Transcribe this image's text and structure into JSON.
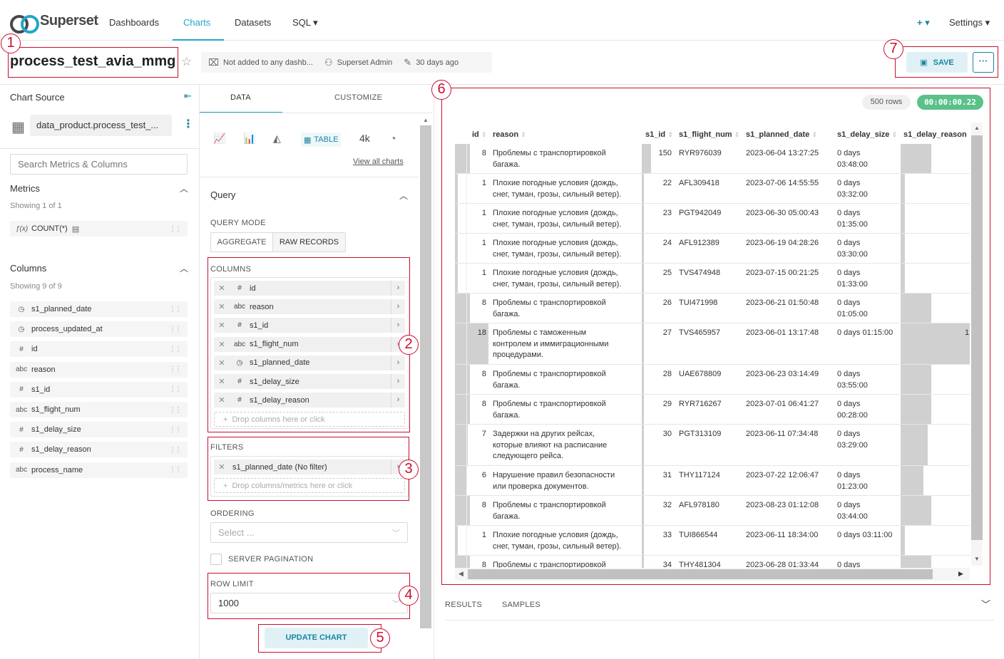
{
  "nav": {
    "brand": "Superset",
    "links": [
      "Dashboards",
      "Charts",
      "Datasets",
      "SQL ▾"
    ],
    "plus": "+ ▾",
    "settings": "Settings ▾"
  },
  "header": {
    "title": "process_test_avia_mmg",
    "dashboards": "Not added to any dashb...",
    "owner": "Superset Admin",
    "modified": "30 days ago",
    "save": "SAVE",
    "more": "···"
  },
  "annotations": [
    "1",
    "2",
    "3",
    "4",
    "5",
    "6",
    "7"
  ],
  "left": {
    "chart_source": "Chart Source",
    "dataset": "data_product.process_test_...",
    "search_placeholder": "Search Metrics & Columns",
    "metrics_title": "Metrics",
    "metrics_showing": "Showing 1 of 1",
    "metric": "COUNT(*)",
    "columns_title": "Columns",
    "columns_showing": "Showing 9 of 9",
    "columns": [
      {
        "type": "clock",
        "name": "s1_planned_date"
      },
      {
        "type": "clock",
        "name": "process_updated_at"
      },
      {
        "type": "#",
        "name": "id"
      },
      {
        "type": "abc",
        "name": "reason"
      },
      {
        "type": "#",
        "name": "s1_id"
      },
      {
        "type": "abc",
        "name": "s1_flight_num"
      },
      {
        "type": "#",
        "name": "s1_delay_size"
      },
      {
        "type": "#",
        "name": "s1_delay_reason"
      },
      {
        "type": "abc",
        "name": "process_name"
      }
    ]
  },
  "control": {
    "tab_data": "DATA",
    "tab_customize": "CUSTOMIZE",
    "viz_table": "TABLE",
    "viz_bignum": "4k",
    "view_all": "View all charts",
    "query_title": "Query",
    "query_mode": "QUERY MODE",
    "mode_aggregate": "AGGREGATE",
    "mode_raw": "RAW RECORDS",
    "columns_label": "COLUMNS",
    "selected_columns": [
      {
        "type": "#",
        "name": "id"
      },
      {
        "type": "abc",
        "name": "reason"
      },
      {
        "type": "#",
        "name": "s1_id"
      },
      {
        "type": "abc",
        "name": "s1_flight_num"
      },
      {
        "type": "clock",
        "name": "s1_planned_date"
      },
      {
        "type": "#",
        "name": "s1_delay_size"
      },
      {
        "type": "#",
        "name": "s1_delay_reason"
      }
    ],
    "columns_drop": "Drop columns here or click",
    "filters_label": "FILTERS",
    "filter": "s1_planned_date (No filter)",
    "filters_drop": "Drop columns/metrics here or click",
    "ordering_label": "ORDERING",
    "ordering_placeholder": "Select ...",
    "server_pagination": "SERVER PAGINATION",
    "row_limit_label": "ROW LIMIT",
    "row_limit": "1000",
    "update": "UPDATE CHART"
  },
  "results": {
    "rows_count": "500 rows",
    "time": "00:00:00.22",
    "headers": [
      "id",
      "reason",
      "s1_id",
      "s1_flight_num",
      "s1_planned_date",
      "s1_delay_size",
      "s1_delay_reason"
    ],
    "rows": [
      {
        "id": "8",
        "idfrac": 0.44,
        "reason": [
          "Проблемы с транспортировкой",
          "багажа."
        ],
        "s1_id": "150",
        "sidfrac": 1.0,
        "flight": "RYR976039",
        "date": "2023-06-04 13:27:25",
        "delay": [
          "0 days",
          "03:48:00"
        ],
        "dr": "",
        "drfrac": 0.44
      },
      {
        "id": "1",
        "idfrac": 0.06,
        "reason": [
          "Плохие погодные условия (дождь,",
          "снег, туман, грозы, сильный ветер)."
        ],
        "s1_id": "22",
        "sidfrac": 0.15,
        "flight": "AFL309418",
        "date": "2023-07-06 14:55:55",
        "delay": [
          "0 days",
          "03:32:00"
        ],
        "dr": "",
        "drfrac": 0.06
      },
      {
        "id": "1",
        "idfrac": 0.06,
        "reason": [
          "Плохие погодные условия (дождь,",
          "снег, туман, грозы, сильный ветер)."
        ],
        "s1_id": "23",
        "sidfrac": 0.15,
        "flight": "PGT942049",
        "date": "2023-06-30 05:00:43",
        "delay": [
          "0 days",
          "01:35:00"
        ],
        "dr": "",
        "drfrac": 0.06
      },
      {
        "id": "1",
        "idfrac": 0.06,
        "reason": [
          "Плохие погодные условия (дождь,",
          "снег, туман, грозы, сильный ветер)."
        ],
        "s1_id": "24",
        "sidfrac": 0.16,
        "flight": "AFL912389",
        "date": "2023-06-19 04:28:26",
        "delay": [
          "0 days",
          "03:30:00"
        ],
        "dr": "",
        "drfrac": 0.06
      },
      {
        "id": "1",
        "idfrac": 0.06,
        "reason": [
          "Плохие погодные условия (дождь,",
          "снег, туман, грозы, сильный ветер)."
        ],
        "s1_id": "25",
        "sidfrac": 0.17,
        "flight": "TVS474948",
        "date": "2023-07-15 00:21:25",
        "delay": [
          "0 days",
          "01:33:00"
        ],
        "dr": "",
        "drfrac": 0.06
      },
      {
        "id": "8",
        "idfrac": 0.44,
        "reason": [
          "Проблемы с транспортировкой",
          "багажа."
        ],
        "s1_id": "26",
        "sidfrac": 0.17,
        "flight": "TUI471998",
        "date": "2023-06-21 01:50:48",
        "delay": [
          "0 days",
          "01:05:00"
        ],
        "dr": "",
        "drfrac": 0.44
      },
      {
        "id": "18",
        "idfrac": 1.0,
        "reason": [
          "Проблемы с таможенным",
          "контролем и иммиграционными",
          "процедурами."
        ],
        "s1_id": "27",
        "sidfrac": 0.18,
        "flight": "TVS465957",
        "date": "2023-06-01 13:17:48",
        "delay": [
          "0 days 01:15:00"
        ],
        "dr": "1",
        "drfrac": 1.0
      },
      {
        "id": "8",
        "idfrac": 0.44,
        "reason": [
          "Проблемы с транспортировкой",
          "багажа."
        ],
        "s1_id": "28",
        "sidfrac": 0.19,
        "flight": "UAE678809",
        "date": "2023-06-23 03:14:49",
        "delay": [
          "0 days",
          "03:55:00"
        ],
        "dr": "",
        "drfrac": 0.44
      },
      {
        "id": "8",
        "idfrac": 0.44,
        "reason": [
          "Проблемы с транспортировкой",
          "багажа."
        ],
        "s1_id": "29",
        "sidfrac": 0.19,
        "flight": "RYR716267",
        "date": "2023-07-01 06:41:27",
        "delay": [
          "0 days",
          "00:28:00"
        ],
        "dr": "",
        "drfrac": 0.44
      },
      {
        "id": "7",
        "idfrac": 0.39,
        "reason": [
          "Задержки на других рейсах,",
          "которые влияют на расписание",
          "следующего рейса."
        ],
        "s1_id": "30",
        "sidfrac": 0.2,
        "flight": "PGT313109",
        "date": "2023-06-11 07:34:48",
        "delay": [
          "0 days",
          "03:29:00"
        ],
        "dr": "",
        "drfrac": 0.39
      },
      {
        "id": "6",
        "idfrac": 0.33,
        "reason": [
          "Нарушение правил безопасности",
          "или проверка документов."
        ],
        "s1_id": "31",
        "sidfrac": 0.21,
        "flight": "THY117124",
        "date": "2023-07-22 12:06:47",
        "delay": [
          "0 days",
          "01:23:00"
        ],
        "dr": "",
        "drfrac": 0.33
      },
      {
        "id": "8",
        "idfrac": 0.44,
        "reason": [
          "Проблемы с транспортировкой",
          "багажа."
        ],
        "s1_id": "32",
        "sidfrac": 0.21,
        "flight": "AFL978180",
        "date": "2023-08-23 01:12:08",
        "delay": [
          "0 days",
          "03:44:00"
        ],
        "dr": "",
        "drfrac": 0.44
      },
      {
        "id": "1",
        "idfrac": 0.06,
        "reason": [
          "Плохие погодные условия (дождь,",
          "снег, туман, грозы, сильный ветер)."
        ],
        "s1_id": "33",
        "sidfrac": 0.22,
        "flight": "TUI866544",
        "date": "2023-06-11 18:34:00",
        "delay": [
          "0 days 03:11:00"
        ],
        "dr": "",
        "drfrac": 0.06
      },
      {
        "id": "8",
        "idfrac": 0.44,
        "reason": [
          "Проблемы с транспортировкой"
        ],
        "s1_id": "34",
        "sidfrac": 0.23,
        "flight": "THY481304",
        "date": "2023-06-28 01:33:44",
        "delay": [
          "0 days"
        ],
        "dr": "",
        "drfrac": 0.44
      }
    ],
    "tab_results": "RESULTS",
    "tab_samples": "SAMPLES"
  }
}
